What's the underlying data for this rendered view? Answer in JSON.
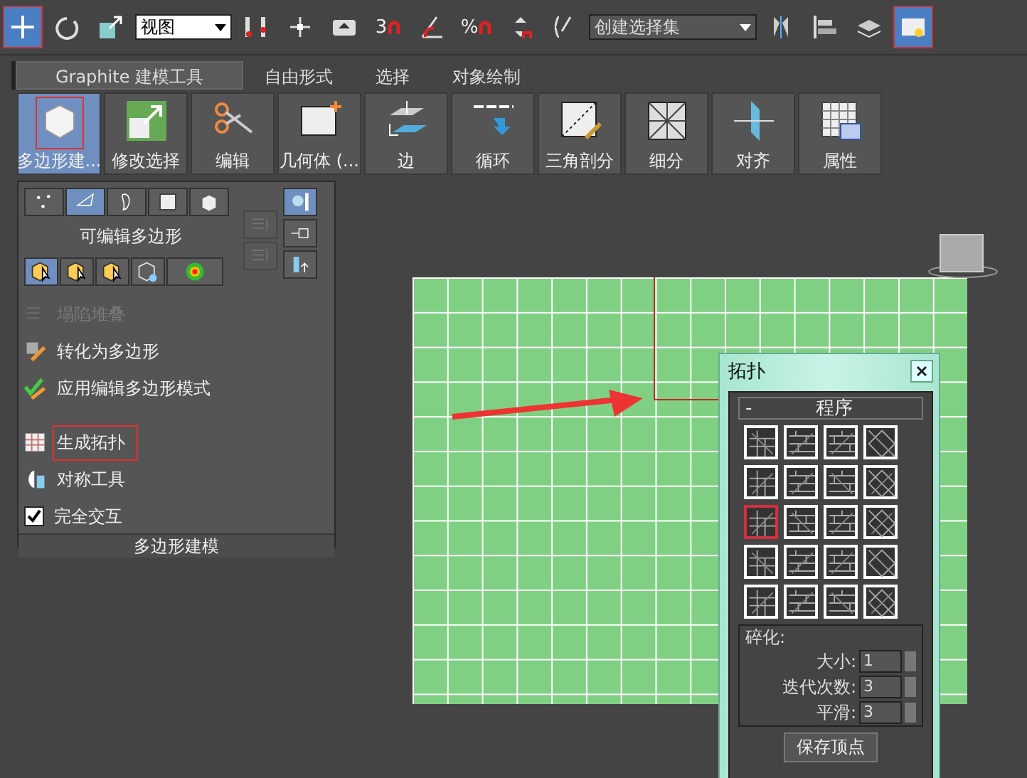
{
  "toolbar": {
    "tools": [
      {
        "kind": "move",
        "selected": true
      },
      {
        "kind": "rotate",
        "selected": false
      },
      {
        "kind": "scale",
        "selected": false
      },
      {
        "kind": "dropdown",
        "value": "视图"
      },
      {
        "kind": "flag",
        "selected": false
      },
      {
        "kind": "pivot",
        "selected": false
      },
      {
        "kind": "upload",
        "selected": false
      },
      {
        "kind": "snap",
        "label": "3",
        "selected": false
      },
      {
        "kind": "angle",
        "selected": false
      },
      {
        "kind": "snap",
        "label": "%",
        "selected": false
      },
      {
        "kind": "spinner",
        "selected": false
      },
      {
        "kind": "edit",
        "selected": false
      },
      {
        "kind": "wide_dropdown",
        "value": "创建选择集"
      },
      {
        "kind": "mirror",
        "selected": false
      },
      {
        "kind": "align",
        "selected": false
      },
      {
        "kind": "layers",
        "selected": false
      },
      {
        "kind": "explorer",
        "selected": true
      }
    ]
  },
  "ribbon_tabs": [
    {
      "label": "Graphite 建模工具",
      "selected": true
    },
    {
      "label": "自由形式",
      "selected": false
    },
    {
      "label": "选择",
      "selected": false
    },
    {
      "label": "对象绘制",
      "selected": false
    }
  ],
  "ribbon_buttons": [
    {
      "label": "多边形建...",
      "selected": true
    },
    {
      "label": "修改选择",
      "selected": false
    },
    {
      "label": "编辑",
      "selected": false
    },
    {
      "label": "几何体 (...",
      "selected": false
    },
    {
      "label": "边",
      "selected": false
    },
    {
      "label": "循环",
      "selected": false
    },
    {
      "label": "三角剖分",
      "selected": false
    },
    {
      "label": "细分",
      "selected": false
    },
    {
      "label": "对齐",
      "selected": false
    },
    {
      "label": "属性",
      "selected": false
    }
  ],
  "panel": {
    "subobject_buttons": [
      {
        "kind": "vertex",
        "selected": false
      },
      {
        "kind": "edge",
        "selected": true
      },
      {
        "kind": "border",
        "selected": false
      },
      {
        "kind": "polygon",
        "selected": false
      },
      {
        "kind": "element",
        "selected": false
      }
    ],
    "title": "可编辑多边形",
    "mode_buttons": [
      {
        "kind": "cube",
        "selected": true
      },
      {
        "kind": "cube",
        "selected": false
      },
      {
        "kind": "cube",
        "selected": false
      },
      {
        "kind": "wire",
        "selected": false
      },
      {
        "kind": "soft",
        "selected": false
      }
    ],
    "side_buttons": [
      {
        "kind": "stack_up",
        "disabled": true,
        "selected": false
      },
      {
        "kind": "stack_down",
        "disabled": true,
        "selected": false
      },
      {
        "kind": "lamp",
        "disabled": false,
        "selected": true
      },
      {
        "kind": "pin",
        "disabled": false,
        "selected": false
      },
      {
        "kind": "tube",
        "disabled": false,
        "selected": false
      }
    ],
    "commands": [
      {
        "label": "塌陷堆叠",
        "kind": "stack",
        "disabled": true,
        "annotated": false
      },
      {
        "label": "转化为多边形",
        "kind": "convert",
        "disabled": false,
        "annotated": false
      },
      {
        "label": "应用编辑多边形模式",
        "kind": "apply",
        "disabled": false,
        "annotated": false
      },
      {
        "label": "生成拓扑",
        "kind": "topology",
        "disabled": false,
        "annotated": true
      },
      {
        "label": "对称工具",
        "kind": "symmetry",
        "disabled": false,
        "annotated": false
      },
      {
        "label": "完全交互",
        "kind": "checkbox",
        "checked": true,
        "annotated": false
      }
    ],
    "footer": "多边形建模"
  },
  "dialog": {
    "title": "拓扑",
    "rollout": {
      "toggle": "-",
      "title": "程序"
    },
    "patterns": [
      {
        "annotated": false
      },
      {
        "annotated": false
      },
      {
        "annotated": false
      },
      {
        "annotated": false
      },
      {
        "annotated": false
      },
      {
        "annotated": false
      },
      {
        "annotated": false
      },
      {
        "annotated": false
      },
      {
        "annotated": true
      },
      {
        "annotated": false
      },
      {
        "annotated": false
      },
      {
        "annotated": false
      },
      {
        "annotated": false
      },
      {
        "annotated": false
      },
      {
        "annotated": false
      },
      {
        "annotated": false
      },
      {
        "annotated": false
      },
      {
        "annotated": false
      },
      {
        "annotated": false
      },
      {
        "annotated": false
      }
    ],
    "group": "碎化:",
    "fields": [
      {
        "label": "大小:",
        "value": "1"
      },
      {
        "label": "迭代次数:",
        "value": "3"
      },
      {
        "label": "平滑:",
        "value": "3"
      }
    ],
    "button": "保存顶点"
  }
}
